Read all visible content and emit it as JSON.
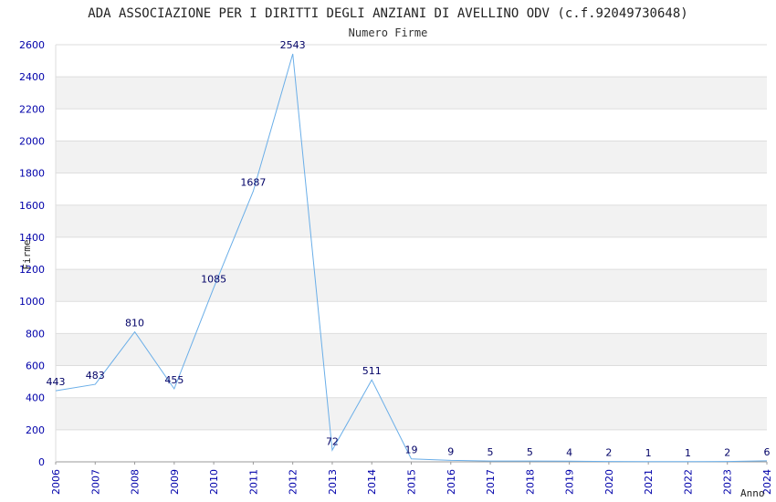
{
  "chart_data": {
    "type": "line",
    "title": "ADA ASSOCIAZIONE PER I DIRITTI DEGLI ANZIANI DI AVELLINO ODV (c.f.92049730648)",
    "subtitle": "Numero Firme",
    "xlabel": "Anno",
    "ylabel": "Firme",
    "x": [
      "2006",
      "2007",
      "2008",
      "2009",
      "2010",
      "2011",
      "2012",
      "2013",
      "2014",
      "2015",
      "2016",
      "2017",
      "2018",
      "2019",
      "2020",
      "2021",
      "2022",
      "2023",
      "2024"
    ],
    "series": [
      {
        "values": [
          443,
          483,
          810,
          455,
          1085,
          1687,
          2543,
          72,
          511,
          19,
          9,
          5,
          5,
          4,
          2,
          1,
          1,
          2,
          6
        ]
      }
    ],
    "ylim": [
      0,
      2600
    ],
    "yticks": [
      0,
      200,
      400,
      600,
      800,
      1000,
      1200,
      1400,
      1600,
      1800,
      2000,
      2200,
      2400,
      2600
    ],
    "grid": true,
    "colors": {
      "line": "#6aaee8",
      "band": "#f2f2f2",
      "grid": "#dddddd",
      "tick_text": "#0000aa",
      "label_text": "#000066"
    }
  }
}
